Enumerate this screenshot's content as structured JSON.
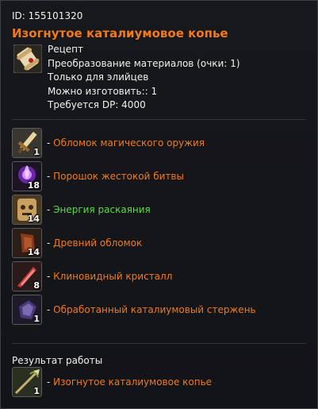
{
  "header": {
    "id_text": "ID: 155101320",
    "title": "Изогнутое каталиумовое копье"
  },
  "recipe": {
    "lines": [
      "Рецепт",
      "Преобразование материалов (очки: 1)",
      "Только для элийцев",
      "Можно изготовить:: 1",
      "Требуется DP: 4000"
    ]
  },
  "materials": [
    {
      "dash": "- ",
      "name": "Обломок магического оружия",
      "count": "1",
      "color": "#f07a1e",
      "icon": "weapon-fragment-icon"
    },
    {
      "dash": "- ",
      "name": "Порошок жестокой битвы",
      "count": "18",
      "color": "#f07a1e",
      "icon": "battle-powder-icon"
    },
    {
      "dash": "- ",
      "name": "Энергия раскаяния",
      "count": "14",
      "color": "#5fd84a",
      "icon": "repentance-energy-icon"
    },
    {
      "dash": "- ",
      "name": "Древний обломок",
      "count": "14",
      "color": "#f07a1e",
      "icon": "ancient-fragment-icon"
    },
    {
      "dash": "- ",
      "name": "Клиновидный кристалл",
      "count": "8",
      "color": "#f07a1e",
      "icon": "wedge-crystal-icon"
    },
    {
      "dash": "- ",
      "name": "Обработанный каталиумовый стержень",
      "count": "1",
      "color": "#f07a1e",
      "icon": "catalium-rod-icon"
    }
  ],
  "result": {
    "label": "Результат работы",
    "dash": "- ",
    "name": "Изогнутое каталиумовое копье",
    "count": "1",
    "icon": "spear-icon"
  }
}
